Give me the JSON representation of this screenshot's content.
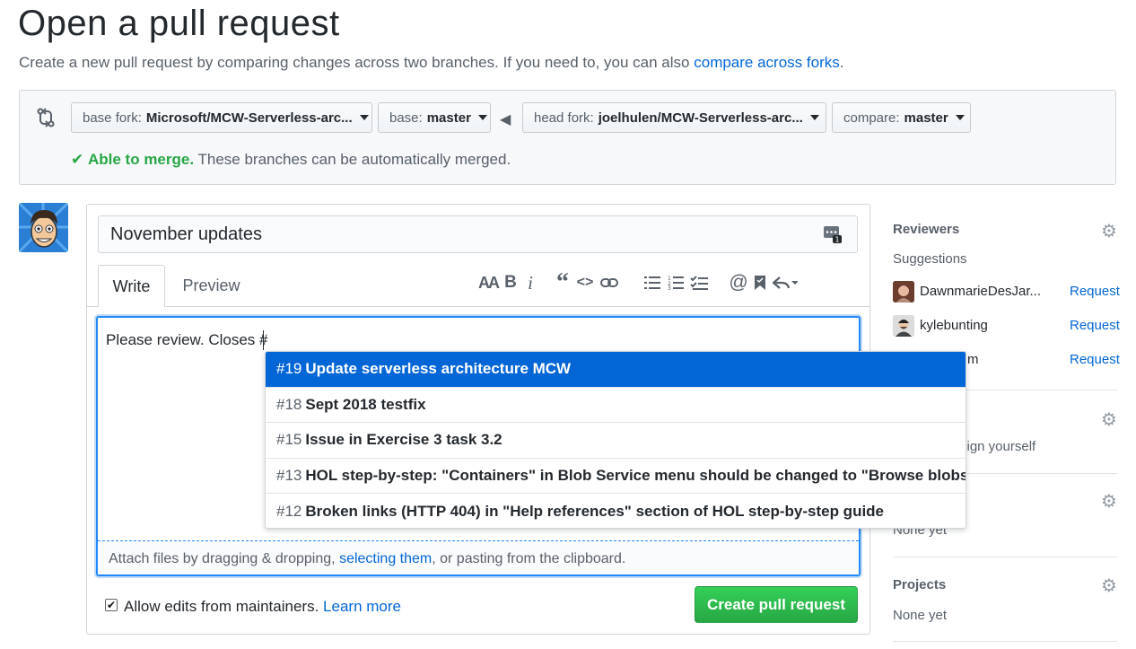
{
  "header": {
    "title": "Open a pull request",
    "subtitle": "Create a new pull request by comparing changes across two branches. If you need to, you can also",
    "compare_link": "compare across forks",
    "subtitle_end": "."
  },
  "compare": {
    "base_fork_label": "base fork:",
    "base_fork_value": "Microsoft/MCW-Serverless-arc...",
    "base_label": "base:",
    "base_value": "master",
    "head_fork_label": "head fork:",
    "head_fork_value": "joelhulen/MCW-Serverless-arc...",
    "compare_label": "compare:",
    "compare_value": "master",
    "merge_status": "Able to merge.",
    "merge_detail": "These branches can be automatically merged."
  },
  "form": {
    "title_value": "November updates",
    "tab_write": "Write",
    "tab_preview": "Preview",
    "body_text": "Please review. Closes #",
    "attach_prefix": "Attach files by dragging & dropping,",
    "attach_link": "selecting them",
    "attach_suffix": ", or pasting from the clipboard.",
    "allow_edits": "Allow edits from maintainers.",
    "learn_more": "Learn more",
    "submit": "Create pull request",
    "toolbar": [
      "header-icon",
      "bold-icon",
      "italic-icon",
      "quote-icon",
      "code-icon",
      "link-icon",
      "bullet-list-icon",
      "numbered-list-icon",
      "task-list-icon",
      "mention-icon",
      "bookmark-icon",
      "reply-icon"
    ]
  },
  "suggestions": [
    {
      "num": "#19",
      "text": "Update serverless architecture MCW",
      "active": true
    },
    {
      "num": "#18",
      "text": "Sept 2018 testfix",
      "active": false
    },
    {
      "num": "#15",
      "text": "Issue in Exercise 3 task 3.2",
      "active": false
    },
    {
      "num": "#13",
      "text": "HOL step-by-step: \"Containers\" in Blob Service menu should be changed to \"Browse blobs\"",
      "active": false
    },
    {
      "num": "#12",
      "text": "Broken links (HTTP 404) in \"Help references\" section of HOL step-by-step guide",
      "active": false
    }
  ],
  "sidebar": {
    "reviewers_title": "Reviewers",
    "suggestions_label": "Suggestions",
    "reviewers": [
      {
        "name": "DawnmarieDesJar...",
        "action": "Request"
      },
      {
        "name": "kylebunting",
        "action": "Request"
      },
      {
        "name": "m",
        "action": "Request"
      }
    ],
    "assign_yourself": "sign yourself",
    "labels_none": "None yet",
    "projects_title": "Projects",
    "projects_none": "None yet"
  },
  "colors": {
    "link": "#0366d6",
    "success": "#28a745",
    "dropdown_active": "#0366d6"
  }
}
